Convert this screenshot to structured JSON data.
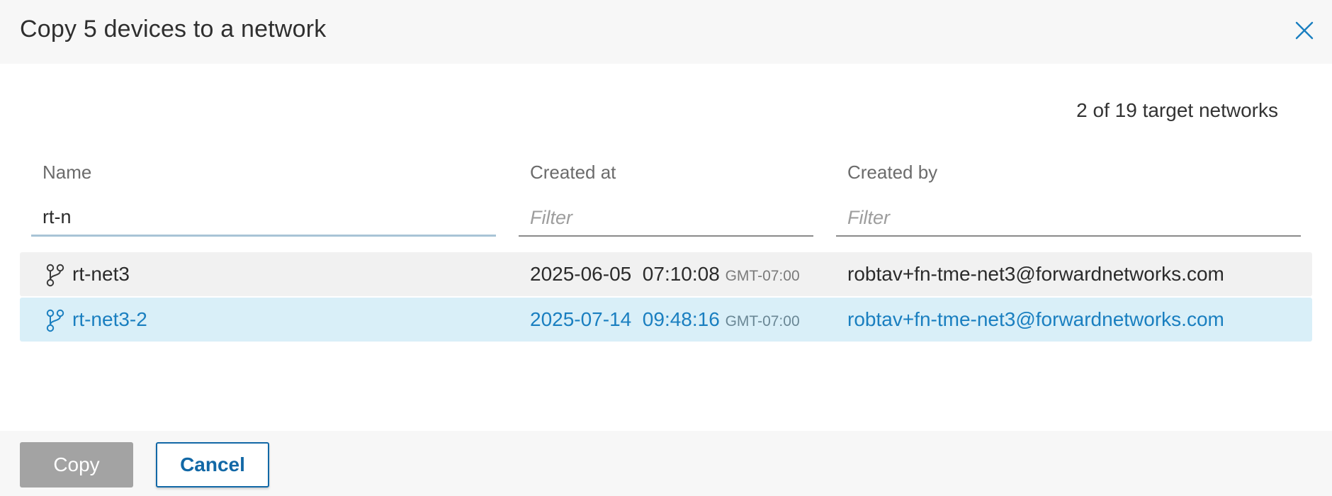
{
  "dialog": {
    "title": "Copy 5 devices to a network",
    "count_text": "2 of 19 target networks"
  },
  "columns": {
    "name": {
      "label": "Name",
      "filter_value": "rt-n",
      "filter_placeholder": "Filter"
    },
    "created_at": {
      "label": "Created at",
      "filter_value": "",
      "filter_placeholder": "Filter"
    },
    "created_by": {
      "label": "Created by",
      "filter_value": "",
      "filter_placeholder": "Filter"
    }
  },
  "rows": [
    {
      "name": "rt-net3",
      "date": "2025-06-05",
      "time": "07:10:08",
      "timezone": "GMT-07:00",
      "created_by": "robtav+fn-tme-net3@forwardnetworks.com",
      "selected": false
    },
    {
      "name": "rt-net3-2",
      "date": "2025-07-14",
      "time": "09:48:16",
      "timezone": "GMT-07:00",
      "created_by": "robtav+fn-tme-net3@forwardnetworks.com",
      "selected": true
    }
  ],
  "buttons": {
    "copy": "Copy",
    "cancel": "Cancel"
  },
  "colors": {
    "accent": "#1268a6",
    "selected_row_bg": "#d9eff8",
    "selected_text": "#1a7fc0",
    "disabled_button": "#a3a3a3"
  },
  "icons": {
    "close": "close-icon",
    "network": "branch-icon"
  }
}
